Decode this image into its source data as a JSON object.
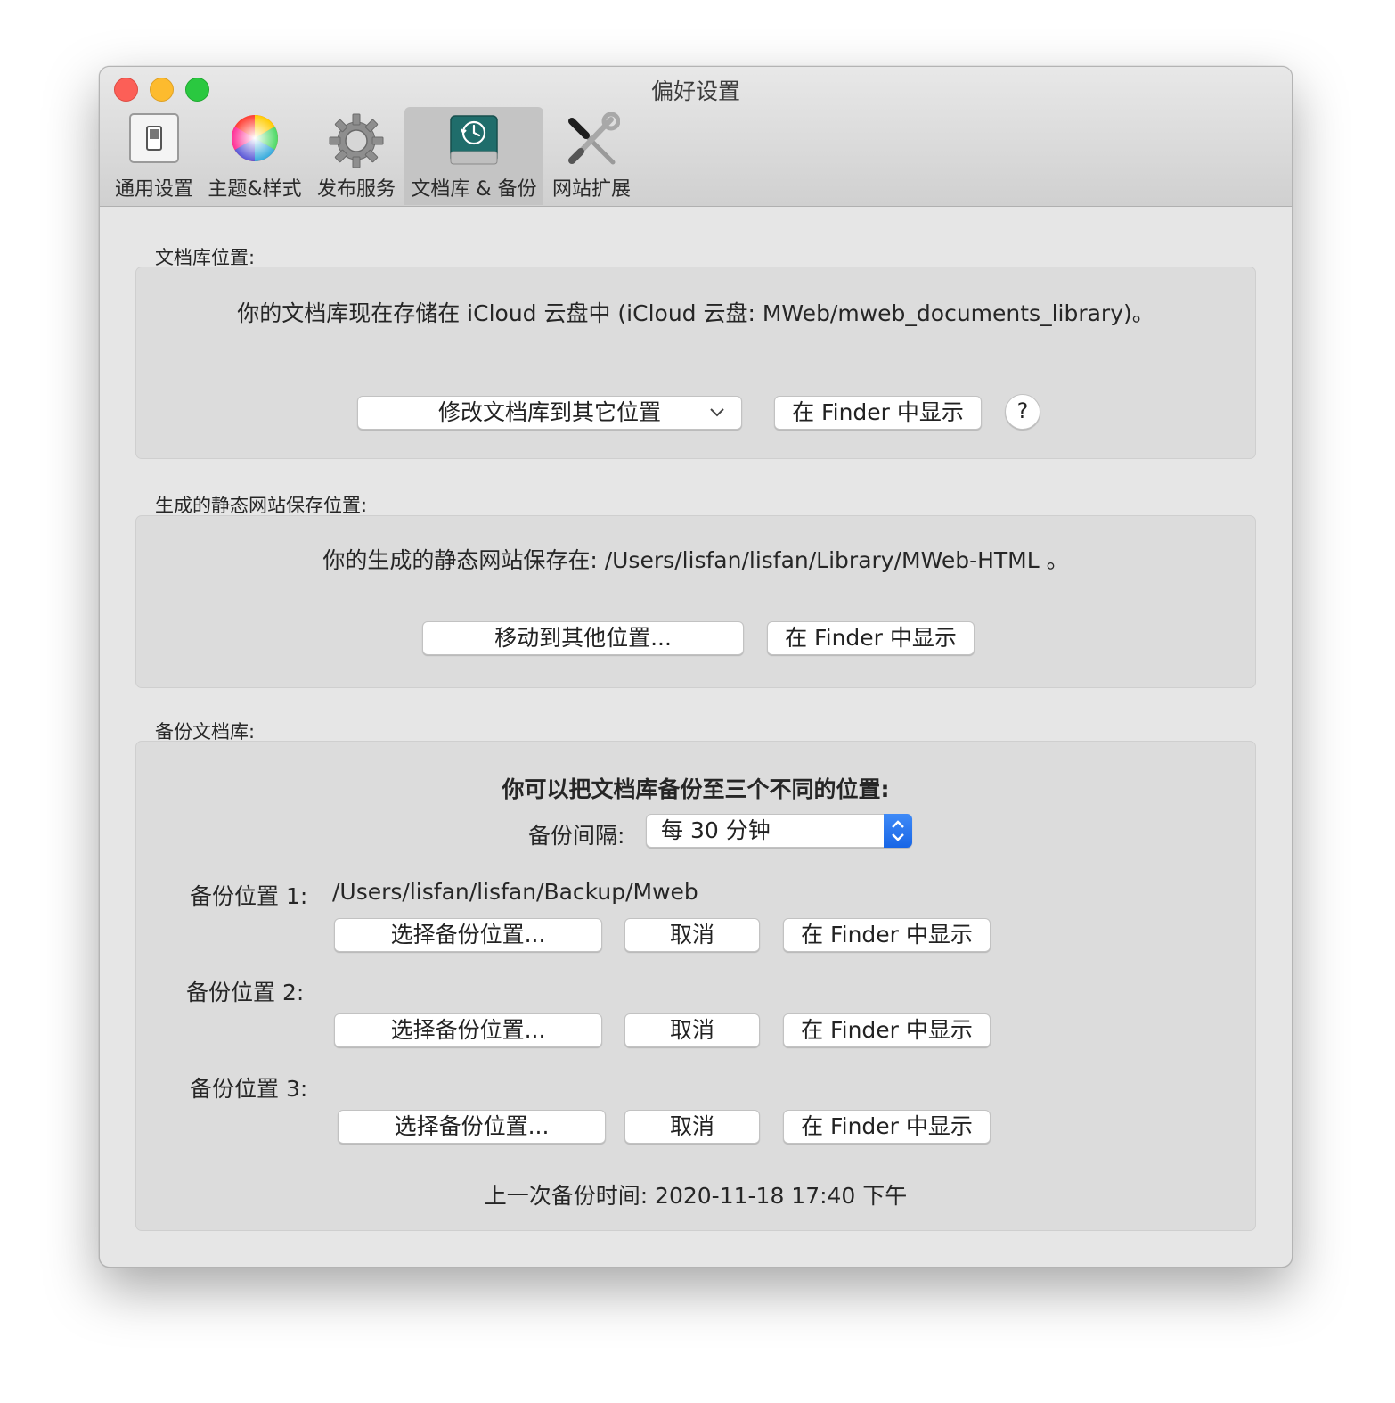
{
  "window": {
    "title": "偏好设置"
  },
  "tabs": [
    {
      "label": "通用设置",
      "icon": "switch-icon"
    },
    {
      "label": "主题&样式",
      "icon": "color-wheel-icon"
    },
    {
      "label": "发布服务",
      "icon": "gear-icon"
    },
    {
      "label": "文档库 & 备份",
      "icon": "time-machine-drive-icon",
      "active": true
    },
    {
      "label": "网站扩展",
      "icon": "tools-icon"
    }
  ],
  "library": {
    "section_label": "文档库位置:",
    "status": "你的文档库现在存储在 iCloud 云盘中 (iCloud 云盘: MWeb/mweb_documents_library)。",
    "change_popup": "修改文档库到其它位置",
    "finder_button": "在 Finder 中显示",
    "help_button": "?"
  },
  "static_site": {
    "section_label": "生成的静态网站保存位置:",
    "status": "你的生成的静态网站保存在: /Users/lisfan/lisfan/Library/MWeb-HTML 。",
    "move_button": "移动到其他位置...",
    "finder_button": "在 Finder 中显示"
  },
  "backup": {
    "section_label": "备份文档库:",
    "heading": "你可以把文档库备份至三个不同的位置:",
    "interval_label": "备份间隔:",
    "interval_value": "每 30 分钟",
    "locations": [
      {
        "label": "备份位置 1:",
        "path": "/Users/lisfan/lisfan/Backup/Mweb",
        "choose": "选择备份位置...",
        "cancel": "取消",
        "finder": "在 Finder 中显示"
      },
      {
        "label": "备份位置 2:",
        "path": "",
        "choose": "选择备份位置...",
        "cancel": "取消",
        "finder": "在 Finder 中显示"
      },
      {
        "label": "备份位置 3:",
        "path": "",
        "choose": "选择备份位置...",
        "cancel": "取消",
        "finder": "在 Finder 中显示"
      }
    ],
    "last_backup": "上一次备份时间: 2020-11-18 17:40 下午"
  },
  "colors": {
    "close": "#fc5f57",
    "minimize": "#fdbb2e",
    "maximize": "#2ac840",
    "accent": "#1866e6"
  }
}
